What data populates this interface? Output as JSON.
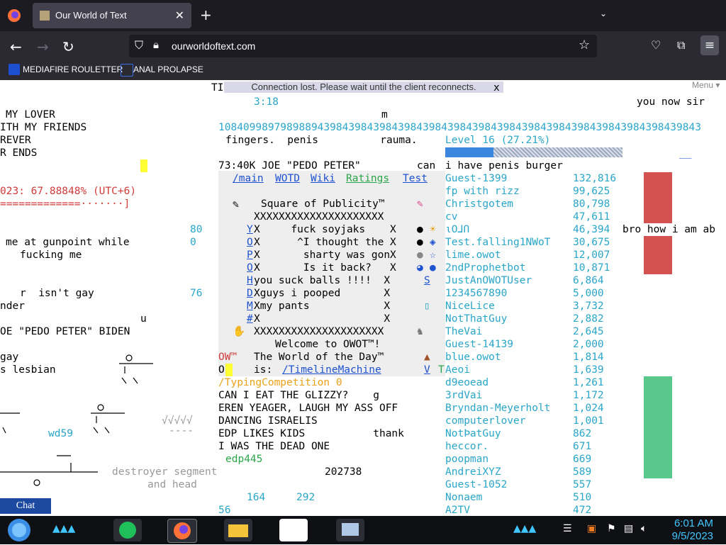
{
  "browser": {
    "tab_title": "Our World of Text",
    "url": "ourworldoftext.com",
    "bookmarks": [
      "MEDIAFIRE ROULETTER",
      "ANAL PROLAPSE"
    ]
  },
  "page": {
    "banner": "Connection lost. Please wait until the client reconnects.",
    "menu_label": "Menu",
    "top_fragment": "TI",
    "banner_close": "x",
    "time_text": "3:18",
    "you_now": "you now sir",
    "left_lines": [
      "MY LOVER",
      "ITH MY FRIENDS",
      "REVER",
      "R ENDS",
      "023: 67.88848% (UTC+6)",
      "=============·······]",
      "me at gunpoint while",
      "fucking me",
      "r  isn't gay",
      "nder",
      "OE \"PEDO PETER\" BIDEN",
      "gay",
      "s lesbian"
    ],
    "numbers_mid": [
      "80",
      "0",
      "76"
    ],
    "u_text": "u",
    "long_number": "108409989798988943984398439843984398439843984398439843984398439843984398439843",
    "fingers_line": "fingers.  penis          rauma.",
    "k_joe_line": "73:40K JOE \"PEDO PETER\"",
    "can_text": "can",
    "burger": "i have penis burger",
    "m_text": "m",
    "bro_text": "bro how i am ab",
    "level_text": "Level 16 (27.21%)",
    "level_percent": 27.21,
    "nav_links": [
      "/main",
      "WOTD",
      "Wiki",
      "Ratings",
      "Test"
    ],
    "square_title": "Square of Publicity™",
    "x_border": "XXXXXXXXXXXXXXXXXXXXX",
    "square_rows": [
      {
        "key": "Y",
        "text": "X     fuck soyjaks    X"
      },
      {
        "key": "O",
        "text": "X      ^I thought the X"
      },
      {
        "key": "P",
        "text": "X       sharty was gonX"
      },
      {
        "key": "O",
        "text": "X       Is it back?   X"
      },
      {
        "key": "H",
        "text": "you suck balls !!!!  X"
      },
      {
        "key": "D",
        "text": "Xguys i pooped       X"
      },
      {
        "key": "M",
        "text": "Xmy pants            X"
      },
      {
        "key": "#",
        "text": "X                    X"
      }
    ],
    "welcome": "Welcome to OWOT™!",
    "wotd_line": "The World of the Day™",
    "is_label": "is:",
    "wotd_link": "/TimelineMachine",
    "ow_label": "OW™",
    "o_label": "O",
    "v_label": "V",
    "t_label": "T",
    "s_label": "S",
    "typing": "/TypingCompetition 0",
    "body_lines": [
      "CAN I EAT THE GLIZZY?    g",
      "EREN YEAGER, LAUGH MY ASS OFF",
      "DANCING ISRAELIS",
      "EDP LIKES KIDS           thank",
      "I WAS THE DEAD ONE"
    ],
    "edp": "edp445",
    "wd59": "wd59",
    "destroyer": "destroyer segment",
    "and_head": "and head",
    "num_202738": "202738",
    "num_164": "164",
    "num_292": "292",
    "num_56": "56",
    "ascii_v": "√√√√√",
    "ascii_dash": "----",
    "leaderboard": [
      {
        "name": "Guest-1399",
        "score": "132,816"
      },
      {
        "name": "fp with rizz",
        "score": "99,625"
      },
      {
        "name": "Christgotem",
        "score": "80,798"
      },
      {
        "name": "cv",
        "score": "47,611"
      },
      {
        "name": "ιΟ⅃Ո",
        "score": "46,394"
      },
      {
        "name": "Test.falling1NWoT",
        "score": "30,675"
      },
      {
        "name": "lime.owot",
        "score": "12,007"
      },
      {
        "name": "2ndProphetbot",
        "score": "10,871"
      },
      {
        "name": "JustAnOWOTUser",
        "score": "6,864"
      },
      {
        "name": "1234567890",
        "score": "5,000"
      },
      {
        "name": "NiceLice",
        "score": "3,732"
      },
      {
        "name": "NotThatGuy",
        "score": "2,882"
      },
      {
        "name": "TheVai",
        "score": "2,645"
      },
      {
        "name": "Guest-14139",
        "score": "2,000"
      },
      {
        "name": "blue.owot",
        "score": "1,814"
      },
      {
        "name": "Aeoi",
        "score": "1,639"
      },
      {
        "name": "d9eoead",
        "score": "1,261"
      },
      {
        "name": "3rdVai",
        "score": "1,172"
      },
      {
        "name": "Bryndan-Meyerholt",
        "score": "1,024"
      },
      {
        "name": "computerlover",
        "score": "1,001"
      },
      {
        "name": "NotÞatGuy",
        "score": "862"
      },
      {
        "name": "heccor.",
        "score": "671"
      },
      {
        "name": "poopman",
        "score": "669"
      },
      {
        "name": "AndreiXYZ",
        "score": "589"
      },
      {
        "name": "Guest-1052",
        "score": "557"
      },
      {
        "name": "Nonaem",
        "score": "510"
      },
      {
        "name": "A2TV",
        "score": "472"
      }
    ],
    "chat_label": "Chat"
  },
  "taskbar": {
    "time": "6:01 AM",
    "date": "9/5/2023"
  }
}
